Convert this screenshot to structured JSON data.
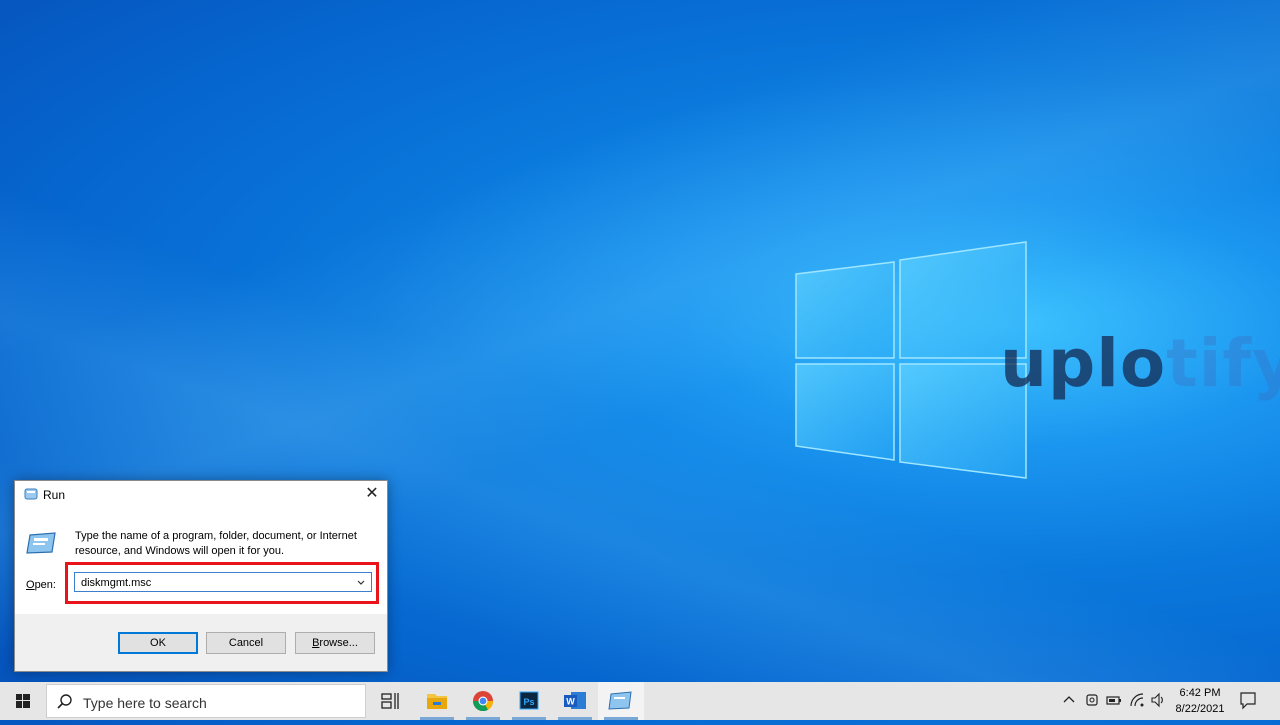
{
  "watermark": {
    "dark_part": "uplo",
    "light_part": "tify"
  },
  "run_dialog": {
    "title": "Run",
    "description": "Type the name of a program, folder, document, or Internet resource, and Windows will open it for you.",
    "open_label_key": "O",
    "open_label_rest": "pen:",
    "input_value": "diskmgmt.msc",
    "ok_label": "OK",
    "cancel_label": "Cancel",
    "browse_key": "B",
    "browse_rest": "rowse..."
  },
  "taskbar": {
    "search_placeholder": "Type here to search",
    "time": "6:42 PM",
    "date": "8/22/2021",
    "apps": [
      "task-view",
      "file-explorer",
      "chrome",
      "photoshop",
      "word",
      "run"
    ]
  },
  "colors": {
    "highlight": "#e8141a",
    "accent": "#0078d7"
  }
}
